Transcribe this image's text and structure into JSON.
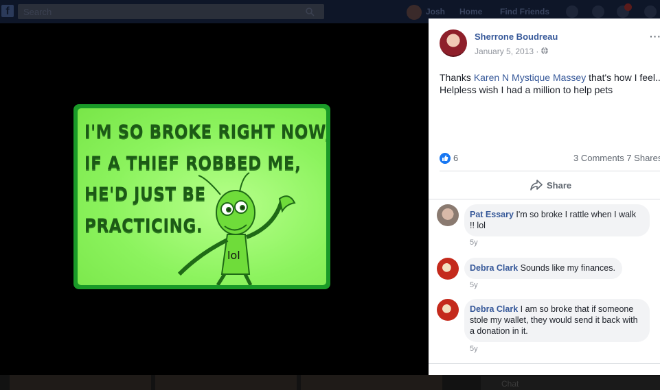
{
  "topbar": {
    "search_placeholder": "Search",
    "nav": [
      "Josh",
      "Home",
      "Find Friends"
    ],
    "notification_count": "2"
  },
  "image": {
    "sign_lines": [
      "I'M SO BROKE RIGHT NOW,",
      "IF A THIEF ROBBED ME,",
      "HE'D JUST BE",
      "PRACTICING."
    ]
  },
  "post": {
    "author": "Sherrone Boudreau",
    "date": "January 5, 2013 · ",
    "text_before": "Thanks ",
    "mention": "Karen N Mystique Massey",
    "text_after": " that's how I feel.. Helpless wish I had a million to help pets",
    "likes": "6",
    "comments_count": "3 Comments",
    "shares_count": "7 Shares",
    "share_label": "Share"
  },
  "comments": [
    {
      "name": "Pat Essary",
      "text": "I'm so broke I rattle when I walk !! lol",
      "time": "5y"
    },
    {
      "name": "Debra Clark",
      "text": "Sounds like my finances.",
      "time": "5y"
    },
    {
      "name": "Debra Clark",
      "text": "I am so broke that if someone stole my wallet, they would send it back with a donation in it.",
      "time": "5y"
    }
  ],
  "chat": {
    "label": "Chat"
  },
  "colors": {
    "link": "#365899",
    "like": "#1877f2",
    "sign_bg": "#8cf35e",
    "sign_border": "#1a9a28"
  }
}
